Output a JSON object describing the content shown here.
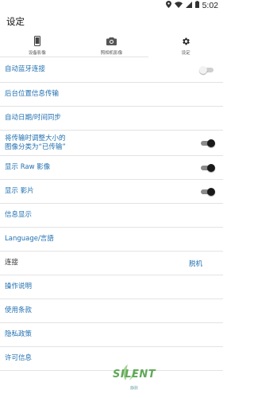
{
  "status_bar": {
    "time": "5:02"
  },
  "app_title": "设定",
  "tabs": [
    {
      "label": "设备影像",
      "icon": "phone-icon"
    },
    {
      "label": "照相机影像",
      "icon": "camera-icon"
    },
    {
      "label": "设定",
      "icon": "gear-icon"
    }
  ],
  "settings": {
    "auto_bt_label": "自动蓝牙连接",
    "auto_bt_state": "off",
    "bg_location_label": "后台位置信息传输",
    "auto_datetime_label": "自动日期/时间同步",
    "resize_label_line1": "将传输时调整大小的",
    "resize_label_line2": "图像分类为“已传输”",
    "resize_state": "on",
    "show_raw_label": "显示 Raw 影像",
    "show_raw_state": "on",
    "show_movie_label": "显示 影片",
    "show_movie_state": "on",
    "info_display_label": "信息显示",
    "language_label": "Language/言語",
    "connection_label": "连接",
    "connection_value": "脱机",
    "instructions_label": "操作说明",
    "terms_label": "使用条款",
    "privacy_label": "隐私政策",
    "license_label": "许可信息"
  },
  "watermark": {
    "text": "SILENT",
    "sub": "静默"
  },
  "colors": {
    "link": "#1f6fb0",
    "divider": "#e3e3e3",
    "accent_green": "#5fa857"
  }
}
